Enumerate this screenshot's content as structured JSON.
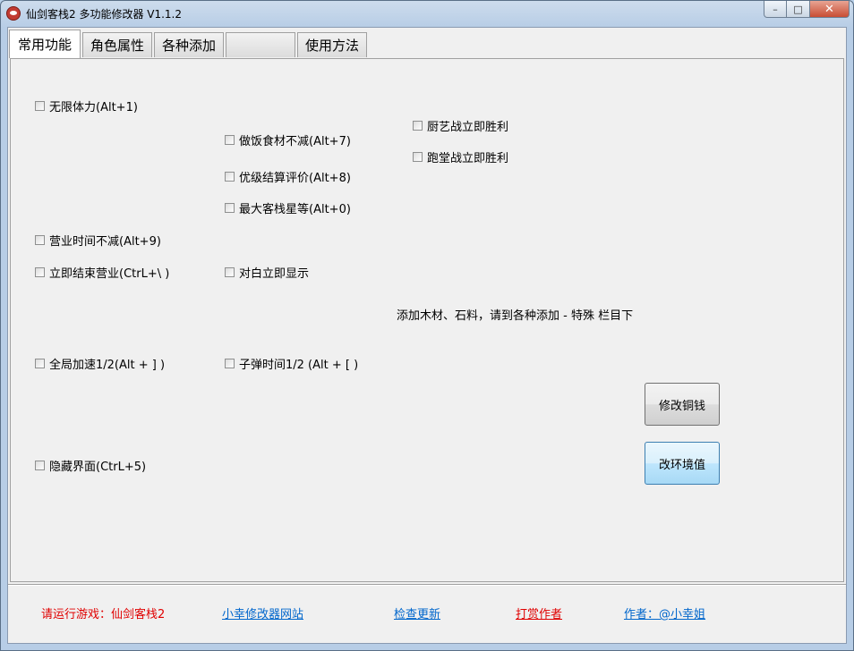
{
  "window": {
    "title": "仙剑客栈2 多功能修改器  V1.1.2",
    "minimize_icon": "minimize-icon",
    "maximize_icon": "maximize-icon",
    "close_icon": "close-icon"
  },
  "tabs": [
    {
      "label": "常用功能",
      "active": true
    },
    {
      "label": "角色属性",
      "active": false
    },
    {
      "label": "各种添加",
      "active": false
    },
    {
      "label": "",
      "active": false
    },
    {
      "label": "使用方法",
      "active": false
    }
  ],
  "options": {
    "unlimited_stamina": "无限体力(Alt+1)",
    "cooking_no_reduce": "做饭食材不减(Alt+7)",
    "cooking_win": "厨艺战立即胜利",
    "running_win": "跑堂战立即胜利",
    "best_rating": "优级结算评价(Alt+8)",
    "max_star": "最大客栈星等(Alt+0)",
    "business_time": "营业时间不减(Alt+9)",
    "end_business": "立即结束营业(CtrL+\\ )",
    "dialog_instant": "对白立即显示",
    "global_speed": "全局加速1/2(Alt + ] )",
    "bullet_time": "子弹时间1/2 (Alt + [ )",
    "hide_ui": "隐藏界面(CtrL+5)"
  },
  "note": "添加木材、石料，请到各种添加 - 特殊 栏目下",
  "buttons": {
    "modify_money": "修改铜钱",
    "modify_env": "改环境值"
  },
  "footer": {
    "status": "请运行游戏：仙剑客栈2",
    "website": "小幸修改器网站",
    "check_update": "检查更新",
    "donate": "打赏作者",
    "author": "作者：@小幸姐"
  }
}
